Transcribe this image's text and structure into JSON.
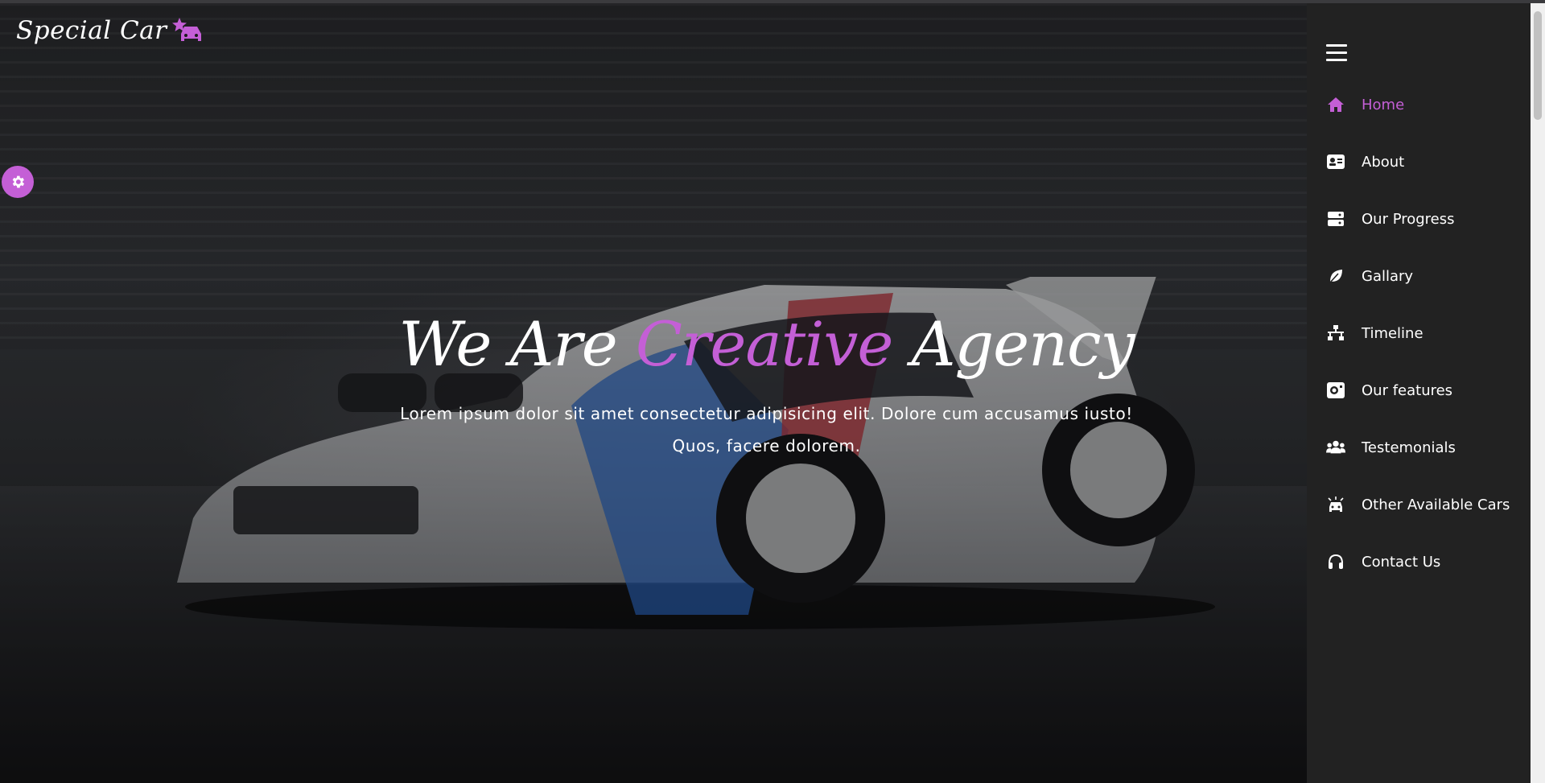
{
  "brand": {
    "logo_text": "Special Car",
    "logo_icon": "car-star-icon"
  },
  "settings": {
    "icon": "gear-icon"
  },
  "hero": {
    "headline_part1": "We Are ",
    "headline_accent": "Creative",
    "headline_part2": " Agency",
    "subtext_line1": "Lorem ipsum dolor sit amet consectetur adipisicing elit. Dolore cum accusamus iusto!",
    "subtext_line2": "Quos, facere dolorem."
  },
  "sidebar": {
    "toggle_icon": "hamburger-icon",
    "items": [
      {
        "label": "Home",
        "icon": "home-icon",
        "active": true
      },
      {
        "label": "About",
        "icon": "id-card-icon"
      },
      {
        "label": "Our Progress",
        "icon": "server-icon"
      },
      {
        "label": "Gallary",
        "icon": "leaf-icon"
      },
      {
        "label": "Timeline",
        "icon": "nodes-icon"
      },
      {
        "label": "Our features",
        "icon": "features-icon"
      },
      {
        "label": "Testemonials",
        "icon": "users-icon"
      },
      {
        "label": "Other Available Cars",
        "icon": "car-icon"
      },
      {
        "label": "Contact Us",
        "icon": "headset-icon"
      }
    ]
  },
  "colors": {
    "accent": "#c45fd6",
    "sidebar_bg": "#222222",
    "text": "#ffffff"
  }
}
